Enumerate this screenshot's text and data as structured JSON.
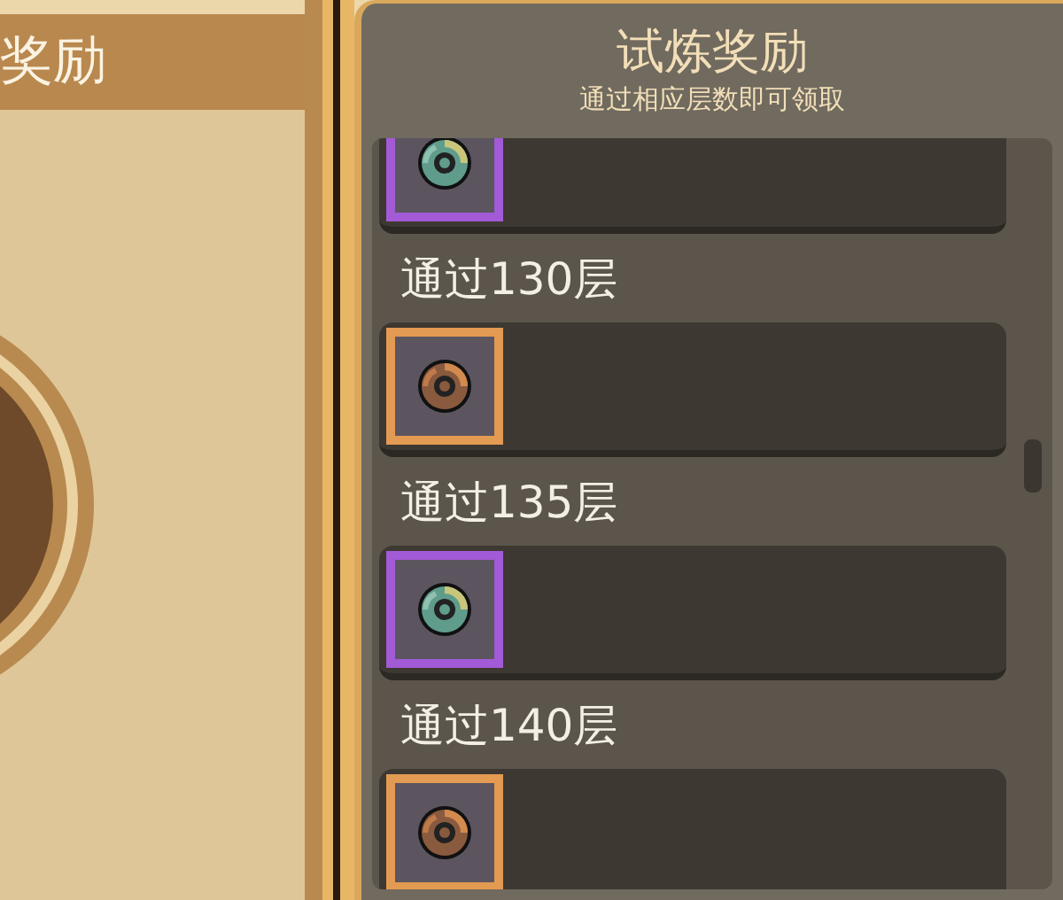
{
  "background_panel": {
    "title": "奖励"
  },
  "reward_panel": {
    "title": "试炼奖励",
    "subtitle": "通过相应层数即可领取"
  },
  "rewards": [
    {
      "color": "#a25ad6"
    },
    {
      "label": "通过130层",
      "color": "#e39a52"
    },
    {
      "label": "通过135层",
      "color": "#a25ad6"
    },
    {
      "label": "通过140层",
      "color": "#e39a52"
    }
  ]
}
